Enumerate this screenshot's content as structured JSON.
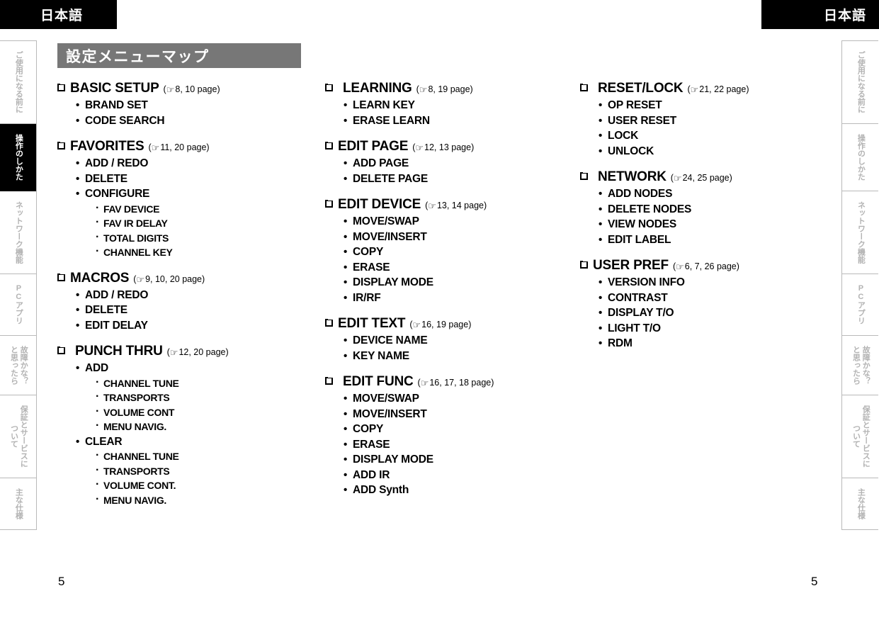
{
  "header": {
    "left_tab_label": "日本語",
    "right_tab_label": "日本語"
  },
  "side_tabs": {
    "items": [
      {
        "label": "ご使用になる前に",
        "active": false
      },
      {
        "label": "操作のしかた",
        "active": true
      },
      {
        "label": "ネットワーク機能",
        "active": false
      },
      {
        "label": "PCアプリ",
        "active": false
      },
      {
        "label": "故障かな？\nと思ったら",
        "active": false
      },
      {
        "label": "保証とサービスに\nついて",
        "active": false
      },
      {
        "label": "主な仕様",
        "active": false
      }
    ],
    "right_items": [
      {
        "label": "ご使用になる前に",
        "active": false
      },
      {
        "label": "操作のしかた",
        "active": false
      },
      {
        "label": "ネットワーク機能",
        "active": false
      },
      {
        "label": "PCアプリ",
        "active": false
      },
      {
        "label": "故障かな？\nと思ったら",
        "active": false
      },
      {
        "label": "保証とサービスに\nついて",
        "active": false
      },
      {
        "label": "主な仕様",
        "active": false
      }
    ]
  },
  "title_bar": {
    "text": "設定メニューマップ"
  },
  "page_numbers": {
    "left": "5",
    "right": "5"
  },
  "icons": {
    "hand": "☞",
    "ref_open": "(",
    "ref_close": ")"
  },
  "colors": {
    "title_bar_bg": "#777777",
    "tab_active_bg": "#000000",
    "tab_inactive_text": "#b3b3b3",
    "text": "#000000"
  },
  "columns": [
    {
      "groups": [
        {
          "title": "BASIC SETUP",
          "ref": "8, 10 page",
          "items": [
            {
              "label": "BRAND SET"
            },
            {
              "label": "CODE SEARCH"
            }
          ]
        },
        {
          "title": "FAVORITES",
          "ref": "11, 20 page",
          "items": [
            {
              "label": "ADD / REDO"
            },
            {
              "label": "DELETE"
            },
            {
              "label": "CONFIGURE",
              "sub": [
                "FAV DEVICE",
                "FAV IR DELAY",
                "TOTAL DIGITS",
                "CHANNEL KEY"
              ]
            }
          ]
        },
        {
          "title": "MACROS",
          "ref": "9, 10, 20 page",
          "items": [
            {
              "label": "ADD / REDO"
            },
            {
              "label": "DELETE"
            },
            {
              "label": "EDIT DELAY"
            }
          ]
        },
        {
          "title": "PUNCH THRU",
          "ref": "12, 20 page",
          "indent": true,
          "items": [
            {
              "label": "ADD",
              "sub": [
                "CHANNEL TUNE",
                "TRANSPORTS",
                "VOLUME CONT",
                "MENU NAVIG."
              ]
            },
            {
              "label": "CLEAR",
              "sub": [
                "CHANNEL TUNE",
                "TRANSPORTS",
                "VOLUME CONT.",
                "MENU NAVIG."
              ]
            }
          ]
        }
      ]
    },
    {
      "groups": [
        {
          "title": "LEARNING",
          "ref": "8, 19 page",
          "indent": true,
          "items": [
            {
              "label": "LEARN KEY"
            },
            {
              "label": "ERASE LEARN"
            }
          ]
        },
        {
          "title": "EDIT PAGE",
          "ref": "12, 13 page",
          "items": [
            {
              "label": "ADD PAGE"
            },
            {
              "label": "DELETE PAGE"
            }
          ]
        },
        {
          "title": "EDIT DEVICE",
          "ref": "13, 14 page",
          "items": [
            {
              "label": "MOVE/SWAP"
            },
            {
              "label": "MOVE/INSERT"
            },
            {
              "label": "COPY"
            },
            {
              "label": "ERASE"
            },
            {
              "label": "DISPLAY MODE"
            },
            {
              "label": "IR/RF"
            }
          ]
        },
        {
          "title": "EDIT TEXT",
          "ref": "16, 19 page",
          "items": [
            {
              "label": "DEVICE NAME"
            },
            {
              "label": "KEY NAME"
            }
          ]
        },
        {
          "title": "EDIT FUNC",
          "ref": "16, 17, 18 page",
          "indent": true,
          "items": [
            {
              "label": "MOVE/SWAP"
            },
            {
              "label": "MOVE/INSERT"
            },
            {
              "label": "COPY"
            },
            {
              "label": "ERASE"
            },
            {
              "label": "DISPLAY MODE"
            },
            {
              "label": "ADD IR"
            },
            {
              "label": "ADD Synth"
            }
          ]
        }
      ]
    },
    {
      "groups": [
        {
          "title": "RESET/LOCK",
          "ref": "21, 22 page",
          "indent": true,
          "items": [
            {
              "label": "OP RESET"
            },
            {
              "label": "USER RESET"
            },
            {
              "label": "LOCK"
            },
            {
              "label": "UNLOCK"
            }
          ]
        },
        {
          "title": "NETWORK",
          "ref": "24, 25 page",
          "indent": true,
          "items": [
            {
              "label": "ADD NODES"
            },
            {
              "label": "DELETE NODES"
            },
            {
              "label": "VIEW NODES"
            },
            {
              "label": "EDIT LABEL"
            }
          ]
        },
        {
          "title": "USER PREF",
          "ref": "6, 7, 26 page",
          "items": [
            {
              "label": "VERSION INFO"
            },
            {
              "label": "CONTRAST"
            },
            {
              "label": "DISPLAY T/O"
            },
            {
              "label": "LIGHT T/O"
            },
            {
              "label": "RDM"
            }
          ]
        }
      ]
    }
  ]
}
